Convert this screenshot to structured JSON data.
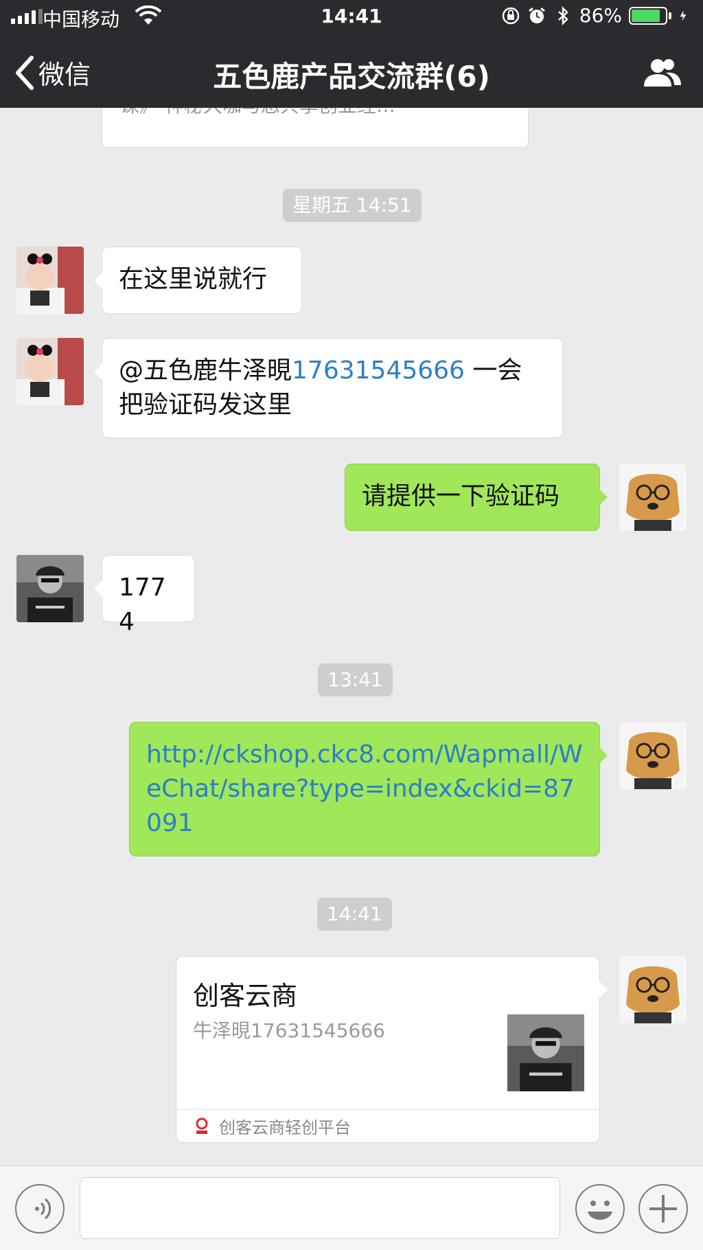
{
  "status_bar": {
    "carrier": "中国移动",
    "time": "14:41",
    "battery_percent": "86%",
    "battery_level": 0.86,
    "icons": [
      "signal-icon",
      "wifi-icon",
      "rotation-lock-icon",
      "alarm-icon",
      "bluetooth-icon",
      "battery-icon",
      "charging-icon"
    ]
  },
  "nav": {
    "back_label": "微信",
    "title": "五色鹿产品交流群(6)",
    "right_icon": "group-members-icon"
  },
  "previous_card": {
    "text": "课》 神秘大咖与您共享创业经…"
  },
  "messages": [
    {
      "type": "timestamp",
      "text": "星期五 14:51"
    },
    {
      "type": "text",
      "side": "left",
      "sender_avatar": "baby-avatar",
      "text": "在这里说就行"
    },
    {
      "type": "text",
      "side": "left",
      "sender_avatar": "baby-avatar",
      "mention": "@五色鹿牛泽晛",
      "mention_number": "17631545666",
      "rest": " 一会把验证码发这里"
    },
    {
      "type": "text",
      "side": "right",
      "sender_avatar": "dog-avatar",
      "text": "请提供一下验证码"
    },
    {
      "type": "text",
      "side": "left",
      "sender_avatar": "man-avatar",
      "text": "1774"
    },
    {
      "type": "timestamp",
      "text": "13:41"
    },
    {
      "type": "link",
      "side": "right",
      "sender_avatar": "dog-avatar",
      "text": "http://ckshop.ckc8.com/Wapmall/WeChat/share?type=index&ckid=87091"
    },
    {
      "type": "timestamp",
      "text": "14:41"
    },
    {
      "type": "share_card",
      "side": "right",
      "sender_avatar": "dog-avatar",
      "title": "创客云商",
      "description": "牛泽晛17631545666",
      "source": "创客云商轻创平台"
    }
  ],
  "input_bar": {
    "icons": [
      "voice-icon",
      "emoji-icon",
      "plus-icon"
    ],
    "placeholder": ""
  },
  "colors": {
    "nav_bg": "#2b2b2f",
    "chat_bg": "#ebebeb",
    "green_bubble": "#a0e75a",
    "link": "#2b7fc7",
    "battery_green": "#4cd964"
  }
}
